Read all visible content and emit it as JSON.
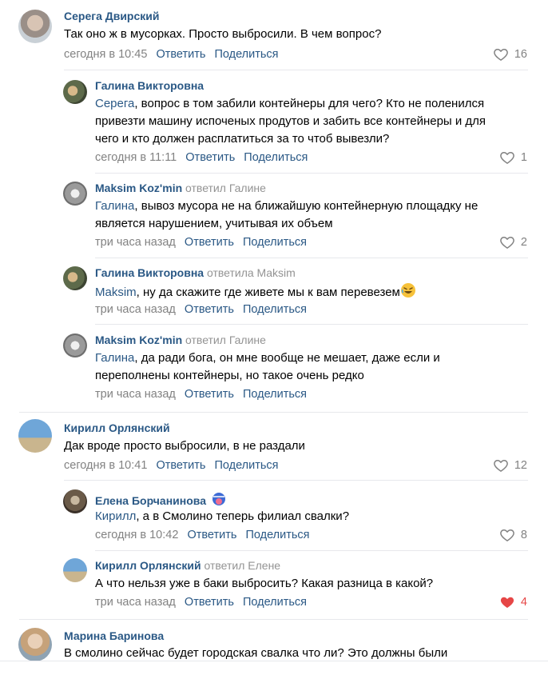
{
  "comments": [
    {
      "author": "Серега Двирский",
      "text": "Так оно ж в мусорках. Просто выбросили. В чем вопрос?",
      "time": "сегодня в 10:45",
      "reply_label": "Ответить",
      "share_label": "Поделиться",
      "likes": "16",
      "liked": false,
      "replies": [
        {
          "author": "Галина Викторовна",
          "mention": "Серега",
          "text_line1_rest": ", вопрос в том забили контейнеры для чего? Кто не поленился",
          "text_line2": "привезти машину испоченых продутов и забить все контейнеры и для",
          "text_line3": "чего и кто должен расплатиться за то чтоб вывезли?",
          "time": "сегодня в 11:11",
          "reply_label": "Ответить",
          "share_label": "Поделиться",
          "likes": "1"
        },
        {
          "author": "Maksim Koz'min",
          "replied_to": "ответил Галине",
          "mention": "Галина",
          "text_line1_rest": ", вывоз мусора не на ближайшую контейнерную площадку не",
          "text_line2": "является нарушением, учитывая их объем",
          "time": "три часа назад",
          "reply_label": "Ответить",
          "share_label": "Поделиться",
          "likes": "2"
        },
        {
          "author": "Галина Викторовна",
          "replied_to": "ответила Maksim",
          "mention": "Maksim",
          "text_line1_rest": ", ну да скажите где живете мы к вам перевезем",
          "time": "три часа назад",
          "reply_label": "Ответить",
          "share_label": "Поделиться",
          "likes": ""
        },
        {
          "author": "Maksim Koz'min",
          "replied_to": "ответил Галине",
          "mention": "Галина",
          "text_line1_rest": ", да ради бога, он мне вообще не мешает, даже если и",
          "text_line2": "переполнены контейнеры, но такое очень редко",
          "time": "три часа назад",
          "reply_label": "Ответить",
          "share_label": "Поделиться",
          "likes": ""
        }
      ]
    },
    {
      "author": "Кирилл Орлянский",
      "text": "Дак вроде просто выбросили, в не раздали",
      "time": "сегодня в 10:41",
      "reply_label": "Ответить",
      "share_label": "Поделиться",
      "likes": "12",
      "replies": [
        {
          "author": "Елена Борчанинова",
          "mention": "Кирилл",
          "text_line1_rest": ", а в Смолино теперь филиал свалки?",
          "time": "сегодня в 10:42",
          "reply_label": "Ответить",
          "share_label": "Поделиться",
          "likes": "8"
        },
        {
          "author": "Кирилл Орлянский",
          "replied_to": "ответил Елене",
          "text": "А что нельзя уже в баки выбросить? Какая разница в какой?",
          "time": "три часа назад",
          "reply_label": "Ответить",
          "share_label": "Поделиться",
          "likes": "4",
          "liked": true
        }
      ]
    },
    {
      "author": "Марина Баринова",
      "text": "В смолино сейчас будет городская свалка что ли? Это должны были"
    }
  ],
  "colors": {
    "link": "#2a5885",
    "meta": "#828282",
    "liked": "#e64646",
    "divider": "#e7e8ec"
  },
  "icons": {
    "like": "heart-icon",
    "emoji": "rofl-emoji-icon",
    "badge": "mask-badge-icon"
  }
}
